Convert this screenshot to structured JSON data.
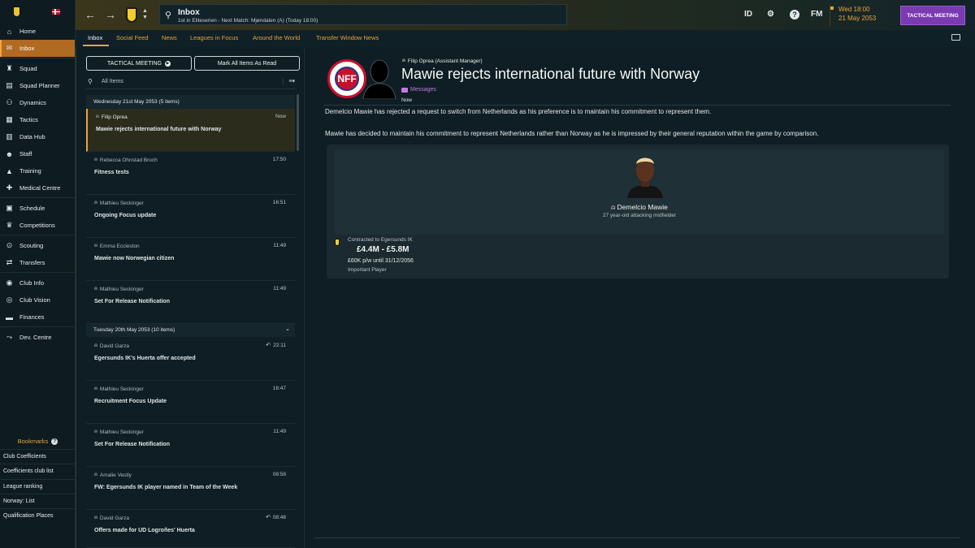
{
  "sidebar": {
    "items": [
      {
        "label": "Home",
        "icon": "house-icon",
        "glyph": "⌂"
      },
      {
        "label": "Inbox",
        "icon": "envelope-icon",
        "glyph": "✉",
        "active": true
      },
      {
        "label": "Squad",
        "icon": "shirt-icon",
        "glyph": "♜"
      },
      {
        "label": "Squad Planner",
        "icon": "planner-icon",
        "glyph": "▤"
      },
      {
        "label": "Dynamics",
        "icon": "dynamics-icon",
        "glyph": "⚇"
      },
      {
        "label": "Tactics",
        "icon": "tactics-icon",
        "glyph": "▦"
      },
      {
        "label": "Data Hub",
        "icon": "data-icon",
        "glyph": "▥"
      },
      {
        "label": "Staff",
        "icon": "staff-icon",
        "glyph": "☻"
      },
      {
        "label": "Training",
        "icon": "training-icon",
        "glyph": "▲"
      },
      {
        "label": "Medical Centre",
        "icon": "medical-icon",
        "glyph": "✚"
      },
      {
        "label": "Schedule",
        "icon": "calendar-icon",
        "glyph": "▣"
      },
      {
        "label": "Competitions",
        "icon": "trophy-icon",
        "glyph": "♛"
      },
      {
        "label": "Scouting",
        "icon": "binoculars-icon",
        "glyph": "⊙"
      },
      {
        "label": "Transfers",
        "icon": "transfer-icon",
        "glyph": "⇄"
      },
      {
        "label": "Club Info",
        "icon": "info-icon",
        "glyph": "◉"
      },
      {
        "label": "Club Vision",
        "icon": "eye-icon",
        "glyph": "◎"
      },
      {
        "label": "Finances",
        "icon": "money-icon",
        "glyph": "▬"
      },
      {
        "label": "Dev. Centre",
        "icon": "dev-centre-icon",
        "glyph": "⤳"
      }
    ],
    "bookmarks_title": "Bookmarks",
    "bookmarks": [
      "Club Coefficients",
      "Coefficients club list",
      "League ranking",
      "Norway: List",
      "Qualification Places"
    ]
  },
  "header": {
    "title": "Inbox",
    "subtitle": "1st in Eliteserien - Next Match: Mjøndalen (A) (Today 18:00)",
    "id_label": "ID",
    "fm_label": "FM",
    "date_line1": "Wed 18:00",
    "date_line2": "21 May 2053",
    "tactical_button": "TACTICAL MEETING"
  },
  "tabs": [
    "Inbox",
    "Social Feed",
    "News",
    "Leagues in Focus",
    "Around the World",
    "Transfer Window News"
  ],
  "inbox": {
    "tactical_meeting_btn": "TACTICAL MEETING",
    "mark_all_btn": "Mark All Items As Read",
    "filter_label": "All Items",
    "groups": [
      {
        "label": "Wednesday 21st May 2053 (5 items)"
      },
      {
        "label": "Tuesday 20th May 2053 (10 items)"
      }
    ],
    "messages": [
      {
        "from": "Filip Oprea",
        "time": "Now",
        "subject": "Mawie rejects international future with Norway"
      },
      {
        "from": "Rebecca Ohnstad Broch",
        "time": "17:50",
        "subject": "Fitness tests"
      },
      {
        "from": "Mathieu Seckinger",
        "time": "16:51",
        "subject": "Ongoing Focus update"
      },
      {
        "from": "Emma Eccleston",
        "time": "11:49",
        "subject": "Mawie now Norwegian citizen"
      },
      {
        "from": "Mathieu Seckinger",
        "time": "11:49",
        "subject": "Set For Release Notification"
      },
      {
        "from": "David Garza",
        "time": "22:11",
        "subject": "Egersunds IK's Huerta offer accepted"
      },
      {
        "from": "Mathieu Seckinger",
        "time": "16:47",
        "subject": "Recruitment Focus Update"
      },
      {
        "from": "Mathieu Seckinger",
        "time": "11:49",
        "subject": "Set For Release Notification"
      },
      {
        "from": "Amalie Vestly",
        "time": "08:58",
        "subject": "FW: Egersunds IK player named in Team of the Week"
      },
      {
        "from": "David Garza",
        "time": "08:48",
        "subject": "Offers made for UD Logroñes' Huerta"
      }
    ]
  },
  "article": {
    "logo_text": "NFF",
    "sender": "Filip Oprea  (Assistant Manager)",
    "headline": "Mawie rejects international future with Norway",
    "tag": "Messages",
    "time": "Now",
    "paragraph1": "Demelcio Mawie has rejected a request to switch from Netherlands as his preference is to maintain his commitment to represent them.",
    "paragraph2": "Mawie has decided to maintain his commitment to represent Netherlands rather than Norway as he is impressed by their general reputation within the game by comparison.",
    "player_name": "Demelcio Mawie",
    "player_desc": "27 year-old attacking midfielder",
    "contracted_to": "Contracted to Egersunds IK",
    "value": "£4.4M - £5.8M",
    "wage": "£60K p/w until 31/12/2056",
    "status": "Important Player"
  },
  "colors": {
    "accent": "#e5a43c",
    "purple": "#7a3bb0",
    "active_nav": "#b06a22"
  }
}
